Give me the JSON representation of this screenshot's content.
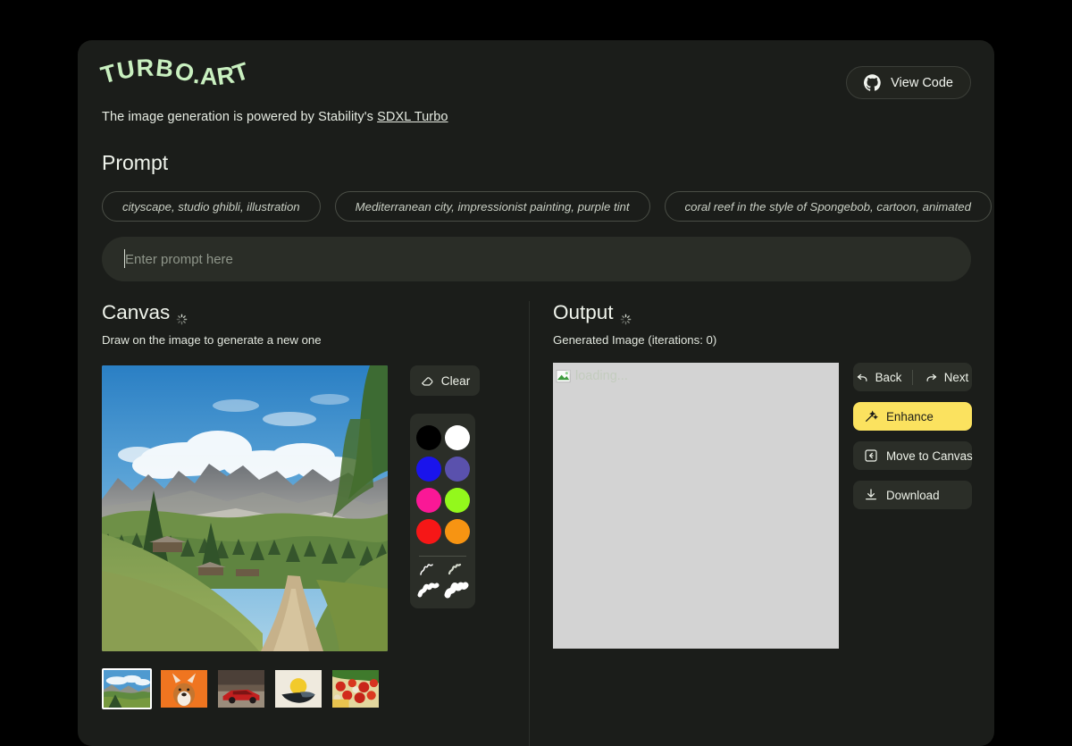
{
  "brand": {
    "logo_text": "TURBO.ART",
    "logo_color": "#c9f0c0"
  },
  "header": {
    "view_code_label": "View Code",
    "view_code_icon": "github-icon",
    "subtitle_prefix": "The image generation is powered by Stability's ",
    "subtitle_link": "SDXL Turbo"
  },
  "prompt": {
    "title": "Prompt",
    "suggestions": [
      "cityscape, studio ghibli, illustration",
      "Mediterranean city, impressionist painting, purple tint",
      "coral reef in the style of Spongebob, cartoon, animated"
    ],
    "input_value": "",
    "placeholder": "Enter prompt here"
  },
  "canvas": {
    "title": "Canvas",
    "spinner_icon": "loading-spinner-icon",
    "subtitle": "Draw on the image to generate a new one",
    "clear_label": "Clear",
    "clear_icon": "eraser-icon",
    "colors": [
      {
        "name": "black",
        "hex": "#000000"
      },
      {
        "name": "white",
        "hex": "#ffffff"
      },
      {
        "name": "blue",
        "hex": "#1a14ec"
      },
      {
        "name": "slate-purple",
        "hex": "#5a51ad"
      },
      {
        "name": "magenta",
        "hex": "#fa1896"
      },
      {
        "name": "lime",
        "hex": "#93f81c"
      },
      {
        "name": "red",
        "hex": "#f61717"
      },
      {
        "name": "orange",
        "hex": "#f79412"
      }
    ],
    "brushes": [
      {
        "name": "brush-size-1",
        "width": 1.6
      },
      {
        "name": "brush-size-2",
        "width": 2.4
      },
      {
        "name": "brush-size-3",
        "width": 5.5
      },
      {
        "name": "brush-size-4",
        "width": 7.5
      }
    ],
    "thumbnails": [
      {
        "name": "mountain-landscape",
        "selected": true
      },
      {
        "name": "corgi-dog",
        "selected": false
      },
      {
        "name": "red-sports-car",
        "selected": false
      },
      {
        "name": "abstract-boat-sun",
        "selected": false
      },
      {
        "name": "tomatoes-food",
        "selected": false
      }
    ]
  },
  "output": {
    "title": "Output",
    "spinner_icon": "loading-spinner-icon",
    "subtitle": "Generated Image (iterations: 0)",
    "image_alt": "loading...",
    "buttons": {
      "back": "Back",
      "next": "Next",
      "enhance": "Enhance",
      "move_to_canvas": "Move to Canvas",
      "download": "Download"
    },
    "enhance_color": "#fbe25f"
  }
}
